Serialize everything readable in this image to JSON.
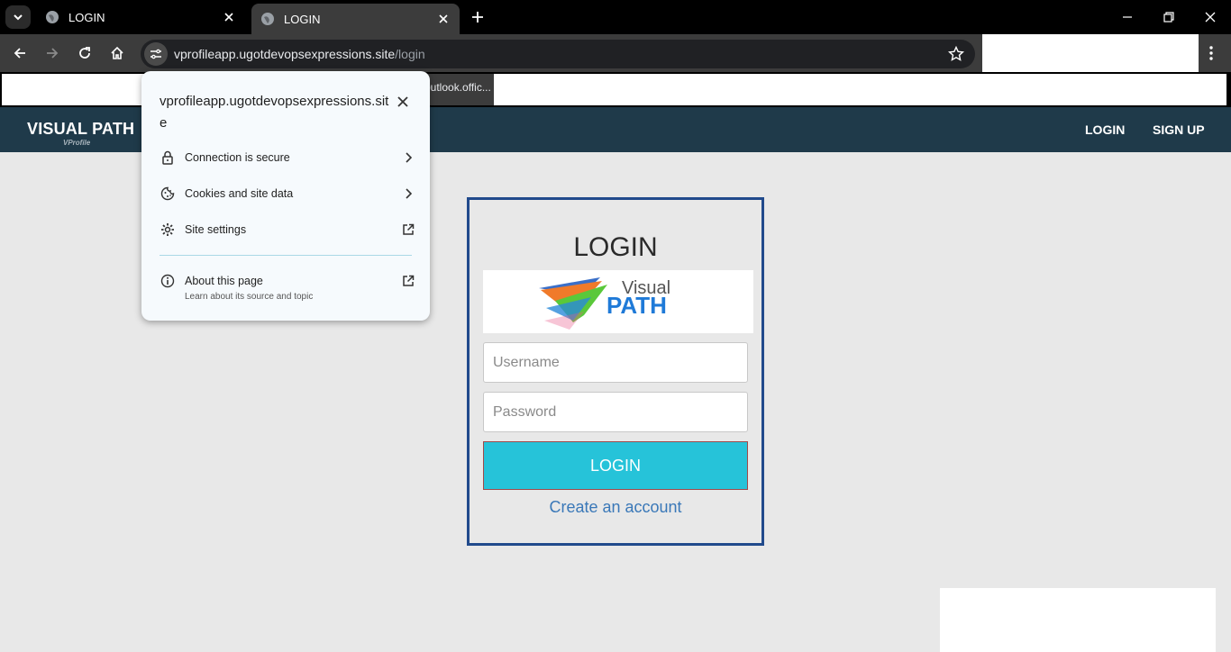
{
  "browser": {
    "tabs": [
      {
        "title": "LOGIN",
        "active": false
      },
      {
        "title": "LOGIN",
        "active": true
      }
    ],
    "url_host": "vprofileapp.ugotdevopsexpressions.site",
    "url_path": "/login",
    "bookmark_item": "outlook.offic..."
  },
  "site_info_popup": {
    "title": "vprofileapp.ugotdevopsexpressions.site",
    "rows": [
      {
        "label": "Connection is secure",
        "icon": "lock-icon"
      },
      {
        "label": "Cookies and site data",
        "icon": "cookie-icon"
      },
      {
        "label": "Site settings",
        "icon": "gear-icon"
      },
      {
        "label": "About this page",
        "icon": "info-icon",
        "sublabel": "Learn about its source and topic"
      }
    ]
  },
  "site": {
    "brand": "VISUAL PATH",
    "brand_sub": "VProfile",
    "nav": {
      "login": "LOGIN",
      "signup": "SIGN UP"
    },
    "colors": {
      "nav_bg": "#1f3a4a",
      "button": "#26c3d9",
      "link": "#3a78b8",
      "panel_border": "#214a8c"
    }
  },
  "login_form": {
    "title": "LOGIN",
    "logo_text_top": "Visual",
    "logo_text_bottom": "PATH",
    "username_placeholder": "Username",
    "password_placeholder": "Password",
    "submit_label": "LOGIN",
    "create_account_link": "Create an account"
  }
}
